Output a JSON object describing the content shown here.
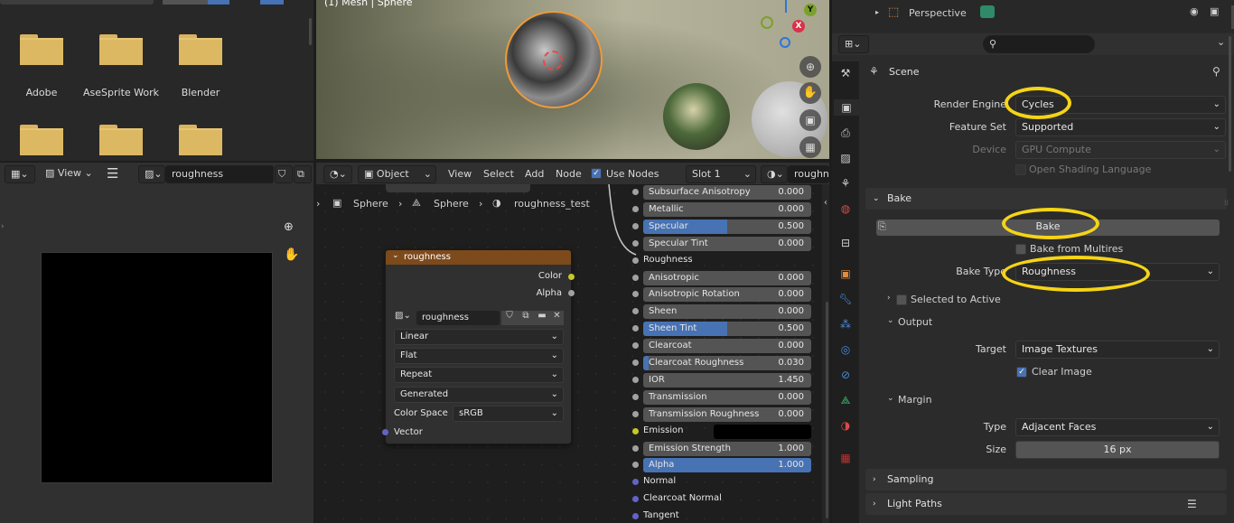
{
  "colors": {
    "accent": "#4772b3",
    "highlight": "#f5d417",
    "socket_yellow": "#c7c729",
    "socket_purple": "#6363c7"
  },
  "file_browser": {
    "folders": [
      "Adobe",
      "AseSprite Work",
      "Blender"
    ]
  },
  "viewport": {
    "title": "(1) Mesh | Sphere",
    "gizmo": {
      "y": "Y",
      "x": "X"
    }
  },
  "image_editor": {
    "menu_view": "View",
    "image_name": "roughness"
  },
  "node_header": {
    "object_label": "Object",
    "menus": [
      "View",
      "Select",
      "Add",
      "Node"
    ],
    "use_nodes_label": "Use Nodes",
    "slot_label": "Slot 1",
    "material_label": "roughne"
  },
  "breadcrumb": {
    "items": [
      "Sphere",
      "Sphere",
      "roughness_test"
    ]
  },
  "image_node": {
    "title": "roughness",
    "outputs": [
      "Color",
      "Alpha"
    ],
    "image_name": "roughness",
    "interpolation": "Linear",
    "projection": "Flat",
    "extension": "Repeat",
    "source": "Generated",
    "color_space_label": "Color Space",
    "color_space": "sRGB",
    "input": "Vector"
  },
  "bsdf_inputs": [
    {
      "label": "Subsurface Anisotropy",
      "value": "0.000",
      "fill": 0
    },
    {
      "label": "Metallic",
      "value": "0.000",
      "fill": 0
    },
    {
      "label": "Specular",
      "value": "0.500",
      "fill": 0.5
    },
    {
      "label": "Specular Tint",
      "value": "0.000",
      "fill": 0
    },
    {
      "label": "Roughness",
      "value": "",
      "fill": 0,
      "socket_only": true
    },
    {
      "label": "Anisotropic",
      "value": "0.000",
      "fill": 0
    },
    {
      "label": "Anisotropic Rotation",
      "value": "0.000",
      "fill": 0
    },
    {
      "label": "Sheen",
      "value": "0.000",
      "fill": 0
    },
    {
      "label": "Sheen Tint",
      "value": "0.500",
      "fill": 0.5
    },
    {
      "label": "Clearcoat",
      "value": "0.000",
      "fill": 0
    },
    {
      "label": "Clearcoat Roughness",
      "value": "0.030",
      "fill": 0.03
    },
    {
      "label": "IOR",
      "value": "1.450",
      "fill": 0
    },
    {
      "label": "Transmission",
      "value": "0.000",
      "fill": 0
    },
    {
      "label": "Transmission Roughness",
      "value": "0.000",
      "fill": 0
    },
    {
      "label": "Emission",
      "value": "",
      "fill": 0,
      "color": true
    },
    {
      "label": "Emission Strength",
      "value": "1.000",
      "fill": 0
    },
    {
      "label": "Alpha",
      "value": "1.000",
      "fill": 1
    },
    {
      "label": "Normal",
      "value": "",
      "fill": 0,
      "socket_only": true
    },
    {
      "label": "Clearcoat Normal",
      "value": "",
      "fill": 0,
      "socket_only": true
    },
    {
      "label": "Tangent",
      "value": "",
      "fill": 0,
      "socket_only": true
    }
  ],
  "outliner": {
    "item": "Perspective"
  },
  "properties": {
    "context": "Scene",
    "render_engine_label": "Render Engine",
    "render_engine": "Cycles",
    "feature_set_label": "Feature Set",
    "feature_set": "Supported",
    "device_label": "Device",
    "device": "GPU Compute",
    "osl_label": "Open Shading Language",
    "bake_panel": "Bake",
    "bake_button": "Bake",
    "bake_multires": "Bake from Multires",
    "bake_type_label": "Bake Type",
    "bake_type": "Roughness",
    "selected_to_active": "Selected to Active",
    "output_panel": "Output",
    "target_label": "Target",
    "target": "Image Textures",
    "clear_image": "Clear Image",
    "margin_panel": "Margin",
    "type_label": "Type",
    "type": "Adjacent Faces",
    "size_label": "Size",
    "size": "16 px",
    "sampling_panel": "Sampling",
    "light_paths_panel": "Light Paths"
  }
}
